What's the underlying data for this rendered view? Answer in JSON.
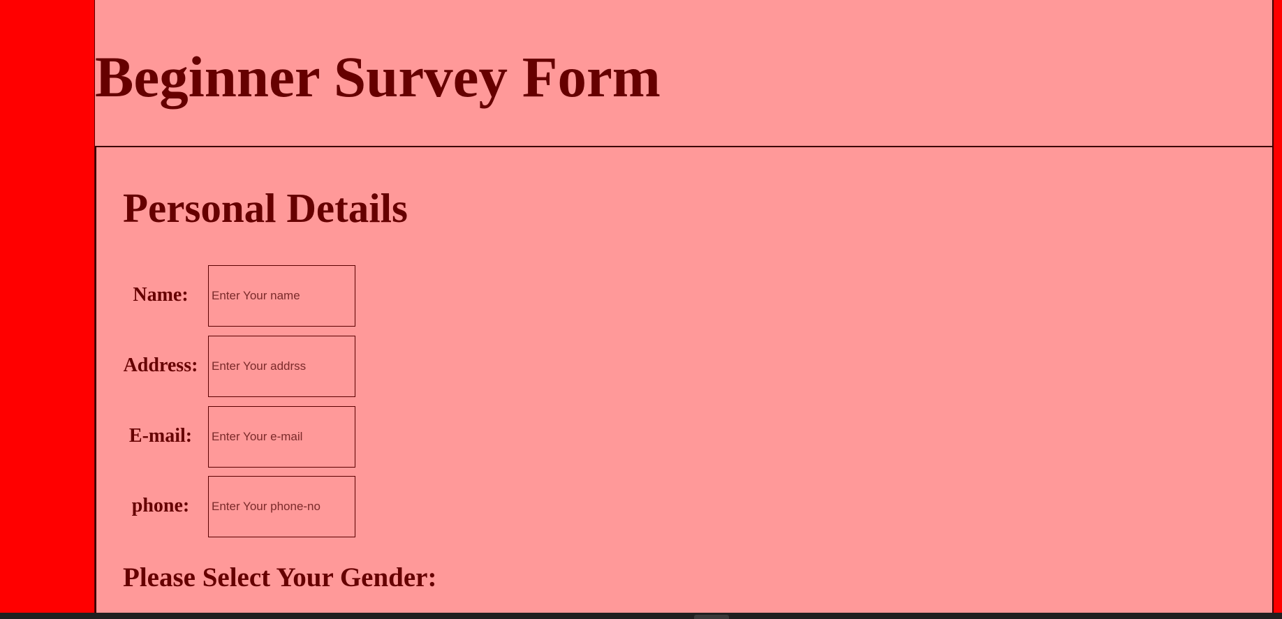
{
  "header": {
    "title": "Beginner Survey Form"
  },
  "personal_details": {
    "heading": "Personal Details",
    "fields": [
      {
        "label": "Name:",
        "placeholder": "Enter Your name",
        "value": ""
      },
      {
        "label": "Address:",
        "placeholder": "Enter Your addrss",
        "value": ""
      },
      {
        "label": "E-mail:",
        "placeholder": "Enter Your e-mail",
        "value": ""
      },
      {
        "label": "phone:",
        "placeholder": "Enter Your phone-no",
        "value": ""
      }
    ]
  },
  "gender": {
    "heading": "Please Select Your Gender:"
  },
  "colors": {
    "outer_background": "#ff0000",
    "page_background": "#ff9999",
    "text": "#660000",
    "taskbar": "#202020"
  }
}
